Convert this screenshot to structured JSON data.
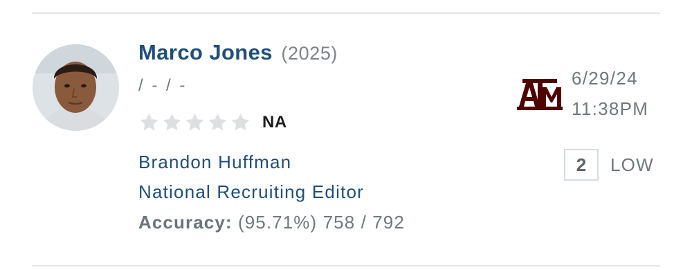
{
  "prediction": {
    "player": {
      "name": "Marco Jones",
      "class_year": "(2025)",
      "measurements": "/ - / -",
      "star_rating": 0,
      "max_stars": 5,
      "rating": "NA"
    },
    "analyst": {
      "name": "Brandon Huffman",
      "title": "National Recruiting Editor",
      "accuracy_label": "Accuracy:",
      "accuracy_value": "(95.71%) 758 / 792"
    },
    "team": {
      "logo_icon": "texas-am-logo",
      "logo_color": "#500000"
    },
    "date": "6/29/24",
    "time": "11:38PM",
    "confidence": {
      "value": "2",
      "level": "LOW"
    }
  },
  "colors": {
    "name_blue": "#1f4e79",
    "muted_gray": "#6f777f",
    "star_empty": "#dddfe1",
    "divider": "#e3e6e9"
  }
}
